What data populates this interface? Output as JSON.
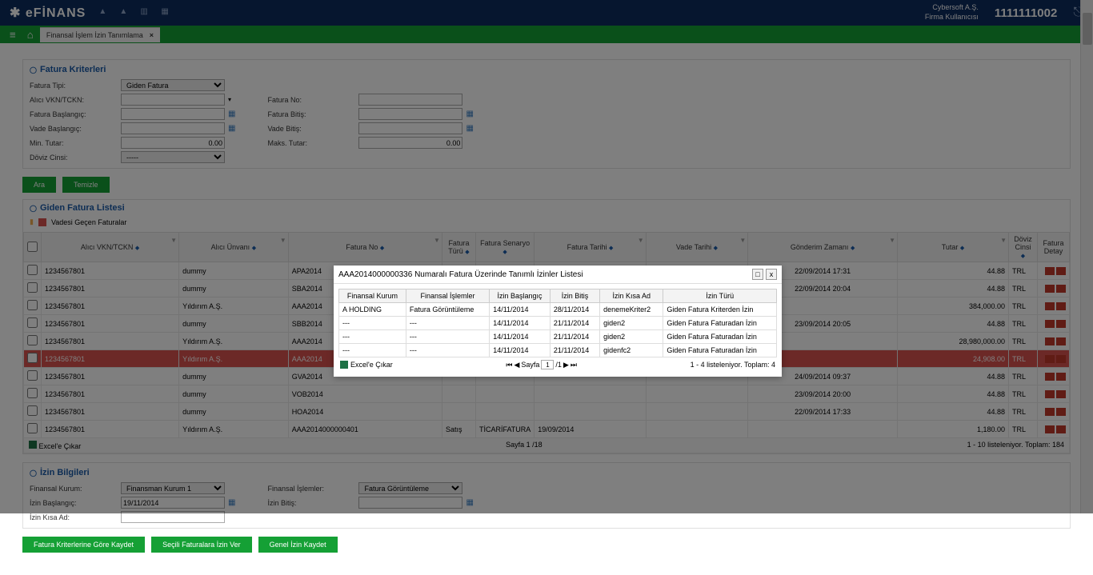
{
  "header": {
    "logo_main": "✱ eFİNANS",
    "client_line1": "Cybersoft A.Ş.",
    "client_line2": "Firma Kullanıcısı",
    "client_id": "1111111002"
  },
  "tab": {
    "title": "Finansal İşlem İzin Tanımlama",
    "close": "×"
  },
  "criteria": {
    "title": "Fatura Kriterleri",
    "labels": {
      "tip": "Fatura Tipi:",
      "vkn": "Alıcı VKN/TCKN:",
      "baslangic": "Fatura Başlangıç:",
      "vade_baslangic": "Vade Başlangıç:",
      "min_tutar": "Min. Tutar:",
      "doviz": "Döviz Cinsi:",
      "fatura_no": "Fatura No:",
      "fatura_bitis": "Fatura Bitiş:",
      "vade_bitis": "Vade Bitiş:",
      "maks_tutar": "Maks. Tutar:"
    },
    "values": {
      "tip": "Giden Fatura",
      "min_tutar": "0.00",
      "maks_tutar": "0.00",
      "doviz": "-----"
    }
  },
  "buttons": {
    "ara": "Ara",
    "temizle": "Temizle",
    "kriter_kaydet": "Fatura Kriterlerine Göre Kaydet",
    "secili_izin": "Seçili Faturalara İzin Ver",
    "genel_izin": "Genel İzin Kaydet"
  },
  "list": {
    "title": "Giden Fatura Listesi",
    "legend": "Vadesi Geçen Faturalar",
    "headers": {
      "vkn": "Alıcı VKN/TCKN",
      "unvan": "Alıcı Ünvanı",
      "fatura_no": "Fatura No",
      "turu": "Fatura Türü",
      "senaryo": "Fatura Senaryo",
      "tarih": "Fatura Tarihi",
      "vade": "Vade Tarihi",
      "gonderim": "Gönderim Zamanı",
      "tutar": "Tutar",
      "doviz": "Döviz Cinsi",
      "detay": "Fatura Detay"
    },
    "rows": [
      {
        "vkn": "1234567801",
        "unvan": "dummy",
        "no": "APA2014",
        "gonderim": "22/09/2014 17:31",
        "tutar": "44.88",
        "doviz": "TRL",
        "overdue": false
      },
      {
        "vkn": "1234567801",
        "unvan": "dummy",
        "no": "SBA2014",
        "gonderim": "22/09/2014 20:04",
        "tutar": "44.88",
        "doviz": "TRL",
        "overdue": false
      },
      {
        "vkn": "1234567801",
        "unvan": "Yıldırım A.Ş.",
        "no": "AAA2014",
        "gonderim": "",
        "tutar": "384,000.00",
        "doviz": "TRL",
        "overdue": false
      },
      {
        "vkn": "1234567801",
        "unvan": "dummy",
        "no": "SBB2014",
        "gonderim": "23/09/2014 20:05",
        "tutar": "44.88",
        "doviz": "TRL",
        "overdue": false
      },
      {
        "vkn": "1234567801",
        "unvan": "Yıldırım A.Ş.",
        "no": "AAA2014",
        "gonderim": "",
        "tutar": "28,980,000.00",
        "doviz": "TRL",
        "overdue": false
      },
      {
        "vkn": "1234567801",
        "unvan": "Yıldırım A.Ş.",
        "no": "AAA2014",
        "gonderim": "",
        "tutar": "24,908.00",
        "doviz": "TRL",
        "overdue": true
      },
      {
        "vkn": "1234567801",
        "unvan": "dummy",
        "no": "GVA2014",
        "gonderim": "24/09/2014 09:37",
        "tutar": "44.88",
        "doviz": "TRL",
        "overdue": false
      },
      {
        "vkn": "1234567801",
        "unvan": "dummy",
        "no": "VOB2014",
        "gonderim": "23/09/2014 20:00",
        "tutar": "44.88",
        "doviz": "TRL",
        "overdue": false
      },
      {
        "vkn": "1234567801",
        "unvan": "dummy",
        "no": "HOA2014",
        "gonderim": "22/09/2014 17:33",
        "tutar": "44.88",
        "doviz": "TRL",
        "overdue": false
      },
      {
        "vkn": "1234567801",
        "unvan": "Yıldırım A.Ş.",
        "no": "AAA2014000000401",
        "turu": "Satış",
        "senaryo": "TİCARİFATURA",
        "tarih": "19/09/2014",
        "gonderim": "",
        "tutar": "1,180.00",
        "doviz": "TRL",
        "overdue": false
      }
    ],
    "export": "Excel'e Çıkar",
    "pager": "Sayfa 1 /18",
    "total": "1 - 10 listeleniyor. Toplam: 184"
  },
  "izin": {
    "title": "İzin Bilgileri",
    "labels": {
      "kurum": "Finansal Kurum:",
      "islemler": "Finansal İşlemler:",
      "baslangic": "İzin Başlangıç:",
      "bitis": "İzin Bitiş:",
      "kisa_ad": "İzin Kısa Ad:"
    },
    "values": {
      "kurum": "Finansman Kurum 1",
      "islemler": "Fatura Görüntüleme",
      "baslangic": "19/11/2014"
    }
  },
  "modal": {
    "title": "AAA2014000000336 Numaralı Fatura Üzerinde Tanımlı İzinler Listesi",
    "headers": {
      "kurum": "Finansal Kurum",
      "islemler": "Finansal İşlemler",
      "baslangic": "İzin Başlangıç",
      "bitis": "İzin Bitiş",
      "kisa_ad": "İzin Kısa Ad",
      "turu": "İzin Türü"
    },
    "rows": [
      {
        "kurum": "A HOLDING",
        "islemler": "Fatura Görüntüleme",
        "baslangic": "14/11/2014",
        "bitis": "28/11/2014",
        "kisa": "denemeKriter2",
        "turu": "Giden Fatura Kriterden İzin"
      },
      {
        "kurum": "---",
        "islemler": "---",
        "baslangic": "14/11/2014",
        "bitis": "21/11/2014",
        "kisa": "giden2",
        "turu": "Giden Fatura Faturadan İzin"
      },
      {
        "kurum": "---",
        "islemler": "---",
        "baslangic": "14/11/2014",
        "bitis": "21/11/2014",
        "kisa": "giden2",
        "turu": "Giden Fatura Faturadan İzin"
      },
      {
        "kurum": "---",
        "islemler": "---",
        "baslangic": "14/11/2014",
        "bitis": "21/11/2014",
        "kisa": "gidenfc2",
        "turu": "Giden Fatura Faturadan İzin"
      }
    ],
    "export": "Excel'e Çıkar",
    "pager_label": "Sayfa",
    "pager_value": "1",
    "pager_total": "/1",
    "total": "1 - 4 listeleniyor. Toplam: 4"
  }
}
